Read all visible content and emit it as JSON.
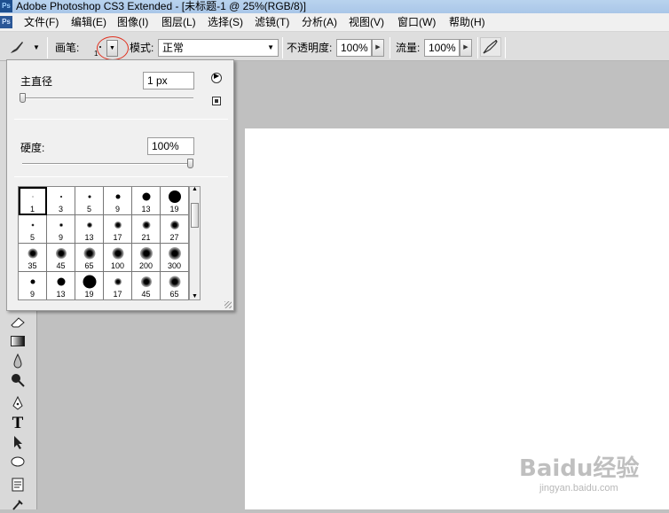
{
  "window": {
    "title": "Adobe Photoshop CS3 Extended - [未标题-1 @ 25%(RGB/8)]",
    "app_icon": "Ps"
  },
  "menu": [
    "文件(F)",
    "编辑(E)",
    "图像(I)",
    "图层(L)",
    "选择(S)",
    "滤镜(T)",
    "分析(A)",
    "视图(V)",
    "窗口(W)",
    "帮助(H)"
  ],
  "options": {
    "brush_label": "画笔:",
    "brush_size_small": "1",
    "mode_label": "模式:",
    "mode_value": "正常",
    "opacity_label": "不透明度:",
    "opacity_value": "100%",
    "flow_label": "流量:",
    "flow_value": "100%"
  },
  "brush_popup": {
    "diameter_label": "主直径",
    "diameter_value": "1 px",
    "hardness_label": "硬度:",
    "hardness_value": "100%",
    "diameter_fraction": 0.0,
    "hardness_fraction": 1.0,
    "presets": [
      {
        "size": "1",
        "kind": "hard",
        "dot": 1
      },
      {
        "size": "3",
        "kind": "hard",
        "dot": 2
      },
      {
        "size": "5",
        "kind": "hard",
        "dot": 3
      },
      {
        "size": "9",
        "kind": "hard",
        "dot": 5
      },
      {
        "size": "13",
        "kind": "hard",
        "dot": 9
      },
      {
        "size": "19",
        "kind": "hard",
        "dot": 14
      },
      {
        "size": "5",
        "kind": "soft",
        "dot": 3
      },
      {
        "size": "9",
        "kind": "soft",
        "dot": 4
      },
      {
        "size": "13",
        "kind": "soft",
        "dot": 6
      },
      {
        "size": "17",
        "kind": "soft",
        "dot": 8
      },
      {
        "size": "21",
        "kind": "soft",
        "dot": 9
      },
      {
        "size": "27",
        "kind": "soft",
        "dot": 10
      },
      {
        "size": "35",
        "kind": "soft",
        "dot": 11
      },
      {
        "size": "45",
        "kind": "soft",
        "dot": 12
      },
      {
        "size": "65",
        "kind": "soft",
        "dot": 13
      },
      {
        "size": "100",
        "kind": "soft",
        "dot": 13
      },
      {
        "size": "200",
        "kind": "soft",
        "dot": 14
      },
      {
        "size": "300",
        "kind": "soft",
        "dot": 14
      },
      {
        "size": "9",
        "kind": "hard",
        "dot": 5
      },
      {
        "size": "13",
        "kind": "hard",
        "dot": 9
      },
      {
        "size": "19",
        "kind": "hard",
        "dot": 15
      },
      {
        "size": "17",
        "kind": "soft",
        "dot": 8
      },
      {
        "size": "45",
        "kind": "soft",
        "dot": 12
      },
      {
        "size": "65",
        "kind": "soft",
        "dot": 13
      }
    ]
  },
  "watermark": {
    "main": "Baidu经验",
    "sub": "jingyan.baidu.com"
  }
}
